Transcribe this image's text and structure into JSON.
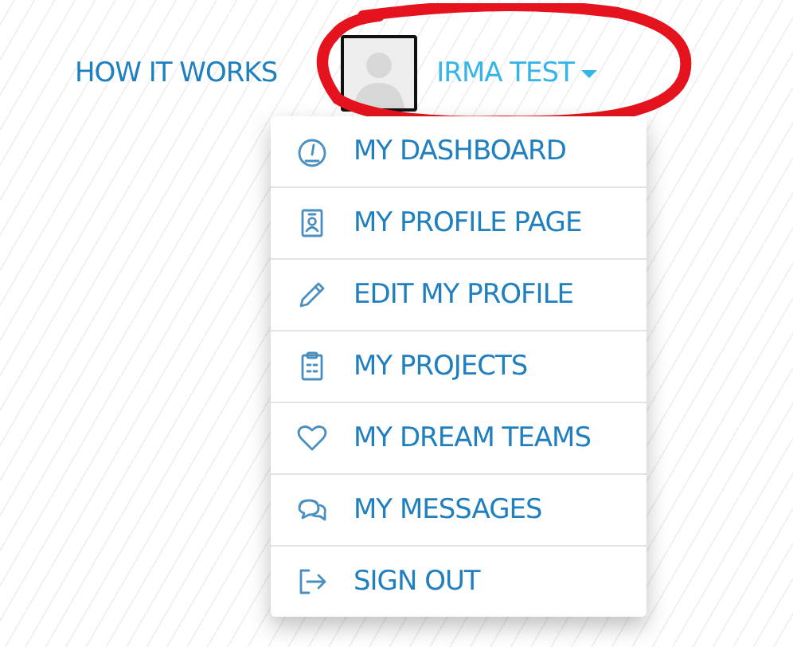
{
  "nav": {
    "link": "HOW IT WORKS",
    "user": {
      "name": "IRMA TEST",
      "expanded": true
    }
  },
  "menu": [
    {
      "kind": "dashboard",
      "label": "MY DASHBOARD"
    },
    {
      "kind": "profile",
      "label": "MY PROFILE PAGE"
    },
    {
      "kind": "edit",
      "label": "EDIT MY PROFILE"
    },
    {
      "kind": "projects",
      "label": "MY PROJECTS"
    },
    {
      "kind": "teams",
      "label": "MY DREAM TEAMS"
    },
    {
      "kind": "messages",
      "label": "MY MESSAGES"
    },
    {
      "kind": "signout",
      "label": "SIGN OUT"
    }
  ]
}
